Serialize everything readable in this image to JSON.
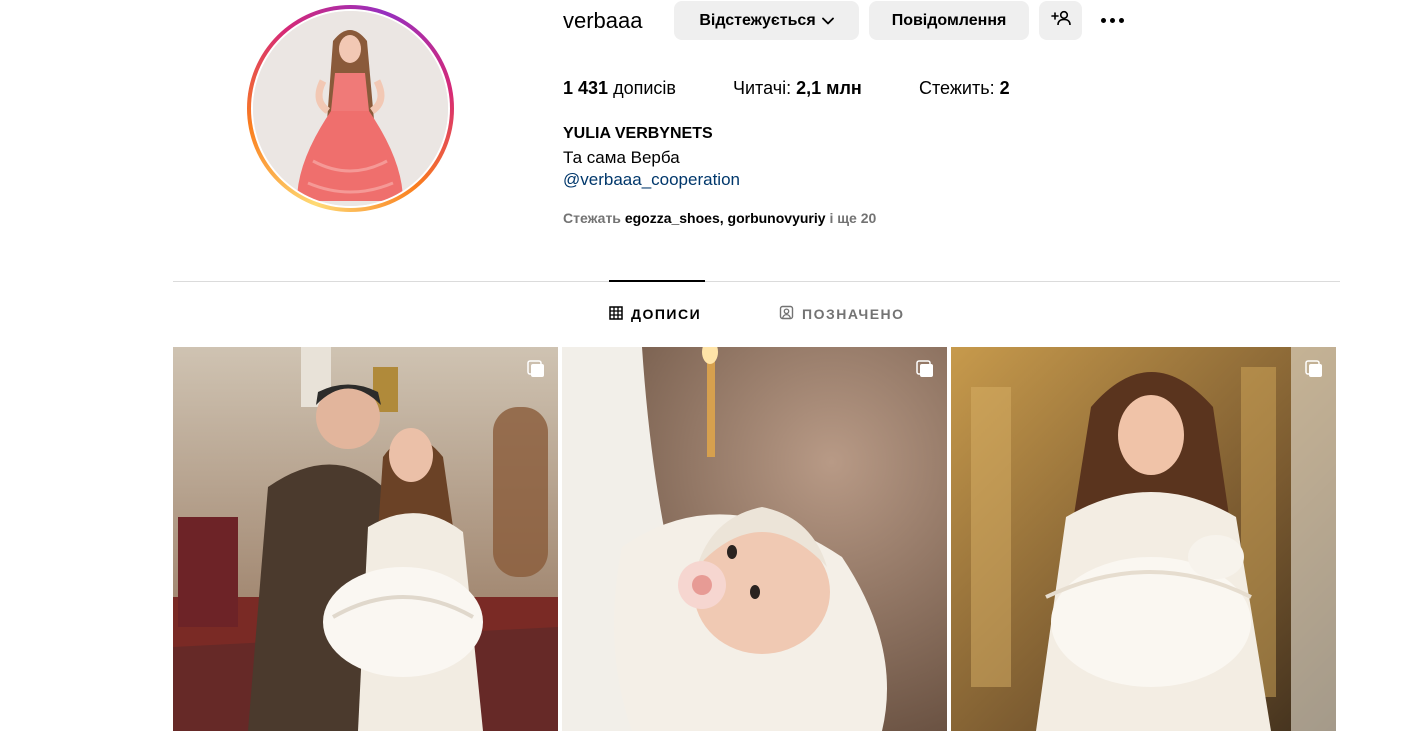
{
  "profile": {
    "username": "verbaaa",
    "follow_button": "Відстежується",
    "message_button": "Повідомлення",
    "stats": {
      "posts_value": "1 431",
      "posts_label": "дописів",
      "followers_label": "Читачі:",
      "followers_value": "2,1 млн",
      "following_label": "Стежить:",
      "following_value": "2"
    },
    "full_name": "YULIA VERBYNETS",
    "bio": "Та сама Верба",
    "bio_link": "@verbaaa_cooperation",
    "followed_by": {
      "prefix": "Стежать",
      "user1": "egozza_shoes",
      "separator": ",",
      "user2": "gorbunovyuriy",
      "suffix": "і ще 20"
    }
  },
  "tabs": [
    {
      "label": "ДОПИСИ",
      "icon": "grid-icon",
      "active": true
    },
    {
      "label": "ПОЗНАЧЕНО",
      "icon": "tagged-icon",
      "active": false
    }
  ],
  "posts": [
    {
      "type": "carousel",
      "icon": "multiple-photos-icon"
    },
    {
      "type": "carousel",
      "icon": "multiple-photos-icon"
    },
    {
      "type": "carousel",
      "icon": "multiple-photos-icon"
    }
  ],
  "colors": {
    "story_ring": [
      "#feda75",
      "#fa7e1e",
      "#d62976",
      "#962fbf"
    ],
    "button_bg": "#efefef",
    "link": "#00376b",
    "secondary_text": "#737373",
    "divider": "#dbdbdb"
  }
}
